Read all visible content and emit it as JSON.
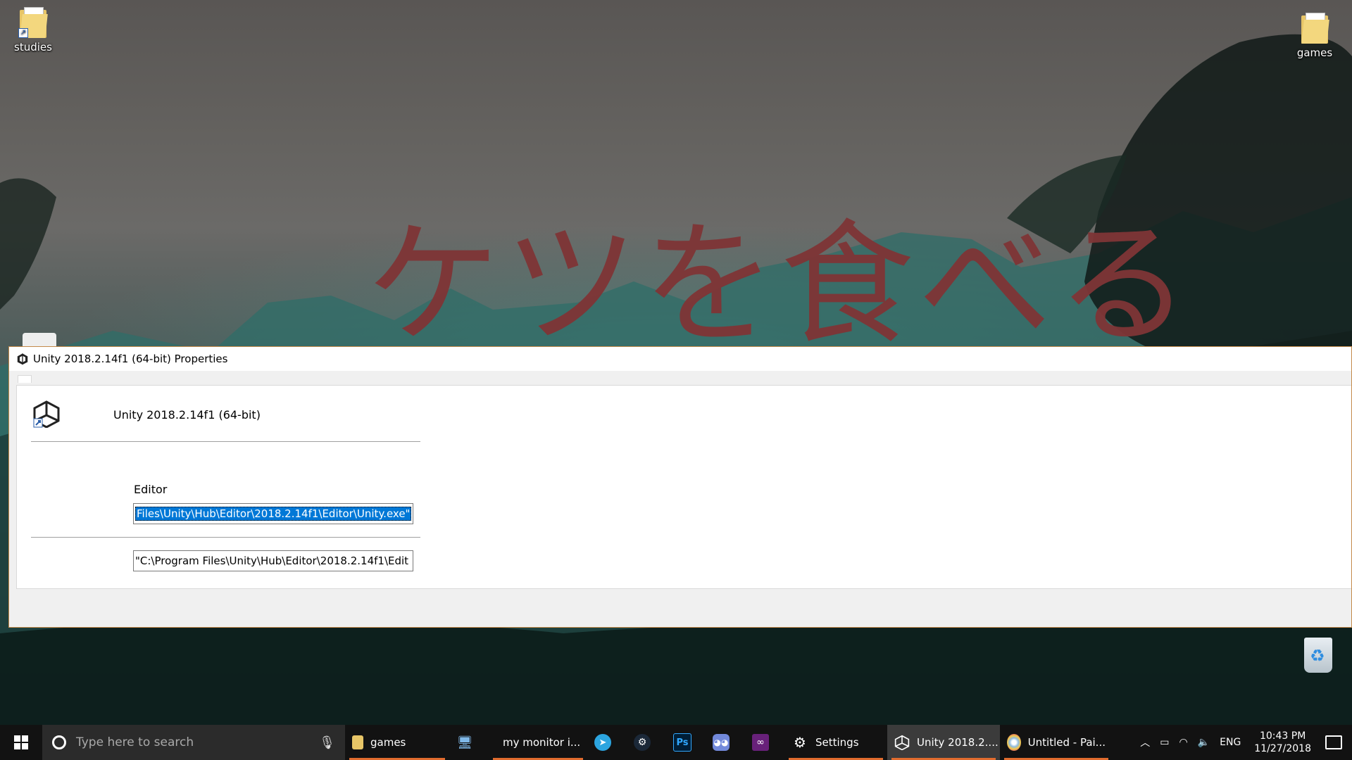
{
  "desktop": {
    "wallpaper_text": "ケツを食べる",
    "icons": [
      {
        "label": "studies"
      },
      {
        "label": "games"
      }
    ]
  },
  "window": {
    "title": "Unity 2018.2.14f1 (64-bit) Properties",
    "app_name": "Unity 2018.2.14f1 (64-bit)",
    "section_label": "Editor",
    "target_value": "Files\\Unity\\Hub\\Editor\\2018.2.14f1\\Editor\\Unity.exe\"",
    "start_in_value": "\"C:\\Program Files\\Unity\\Hub\\Editor\\2018.2.14f1\\Edit"
  },
  "taskbar": {
    "search_placeholder": "Type here to search",
    "items": [
      {
        "label": "games",
        "icon": "folder-icon"
      },
      {
        "label": "",
        "icon": "this-pc-icon"
      },
      {
        "label": "my monitor i...",
        "icon": "firefox-icon"
      },
      {
        "label": "",
        "icon": "telegram-icon"
      },
      {
        "label": "",
        "icon": "steam-icon"
      },
      {
        "label": "Ps",
        "icon": "photoshop-icon"
      },
      {
        "label": "",
        "icon": "discord-icon"
      },
      {
        "label": "",
        "icon": "visual-studio-icon"
      },
      {
        "label": "Settings",
        "icon": "gear-icon"
      },
      {
        "label": "Unity 2018.2....",
        "icon": "unity-icon"
      },
      {
        "label": "Untitled - Pai...",
        "icon": "paint-icon"
      }
    ],
    "tray": {
      "language": "ENG",
      "time": "10:43 PM",
      "date": "11/27/2018"
    }
  },
  "colors": {
    "selection": "#0078d7",
    "taskbar": "#121212",
    "open_indicator": "#e06b2e",
    "wallpaper_text": "#7f3536"
  }
}
